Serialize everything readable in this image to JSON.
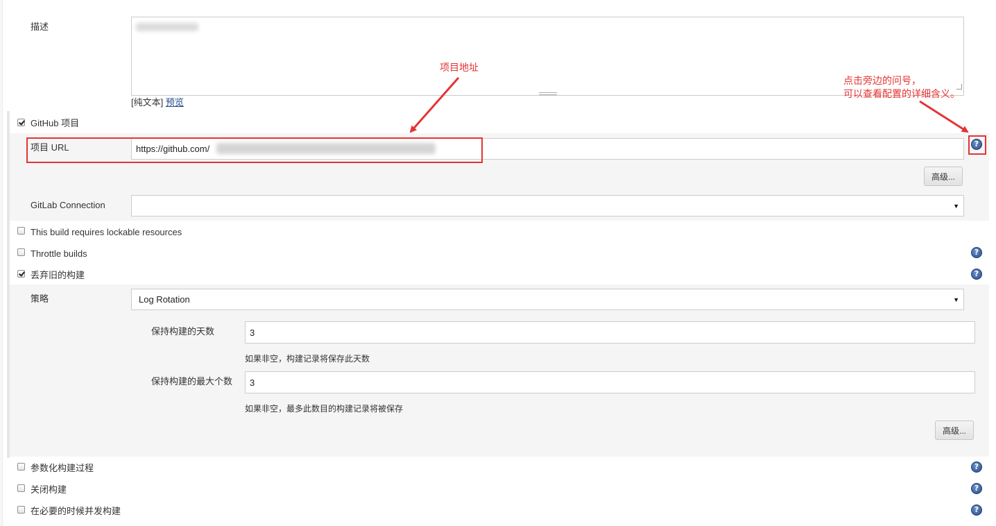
{
  "description": {
    "label": "描述",
    "format_prefix": "[纯文本]",
    "preview_link": "预览"
  },
  "github_project": {
    "checkbox_label": "GitHub 项目",
    "checked": true,
    "url_label": "项目 URL",
    "url_value": "https://github.com/",
    "advanced_button": "高级..."
  },
  "gitlab": {
    "label": "GitLab Connection",
    "value": ""
  },
  "options": [
    {
      "label": "This build requires lockable resources",
      "checked": false
    },
    {
      "label": "Throttle builds",
      "checked": false
    },
    {
      "label": "丢弃旧的构建",
      "checked": true
    }
  ],
  "discard": {
    "strategy_label": "策略",
    "strategy_value": "Log Rotation",
    "days_label": "保持构建的天数",
    "days_value": "3",
    "days_hint": "如果非空，构建记录将保存此天数",
    "max_label": "保持构建的最大个数",
    "max_value": "3",
    "max_hint": "如果非空，最多此数目的构建记录将被保存",
    "advanced_button": "高级..."
  },
  "bottom_options": [
    {
      "label": "参数化构建过程",
      "checked": false
    },
    {
      "label": "关闭构建",
      "checked": false
    },
    {
      "label": "在必要的时候并发构建",
      "checked": false
    }
  ],
  "annotations": {
    "project_address": "项目地址",
    "help_hint_line1": "点击旁边的问号，",
    "help_hint_line2": "可以查看配置的详细含义。",
    "color": "#e53333"
  },
  "help_icon_glyph": "?"
}
